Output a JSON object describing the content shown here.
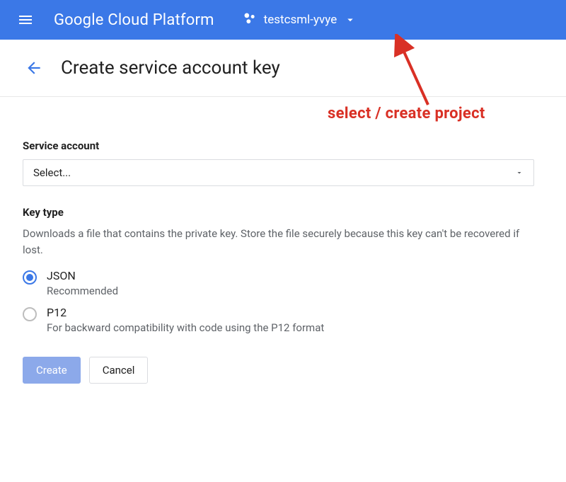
{
  "topbar": {
    "product_name": "Google Cloud Platform",
    "project_name": "testcsml-yvye"
  },
  "page": {
    "title": "Create service account key"
  },
  "annotation": {
    "text": "select / create project"
  },
  "form": {
    "service_account_label": "Service account",
    "service_account_placeholder": "Select...",
    "key_type_label": "Key type",
    "key_type_description": "Downloads a file that contains the private key. Store the file securely because this key can't be recovered if lost.",
    "options": [
      {
        "value": "JSON",
        "sublabel": "Recommended",
        "selected": true
      },
      {
        "value": "P12",
        "sublabel": "For backward compatibility with code using the P12 format",
        "selected": false
      }
    ],
    "buttons": {
      "create": "Create",
      "cancel": "Cancel"
    }
  }
}
